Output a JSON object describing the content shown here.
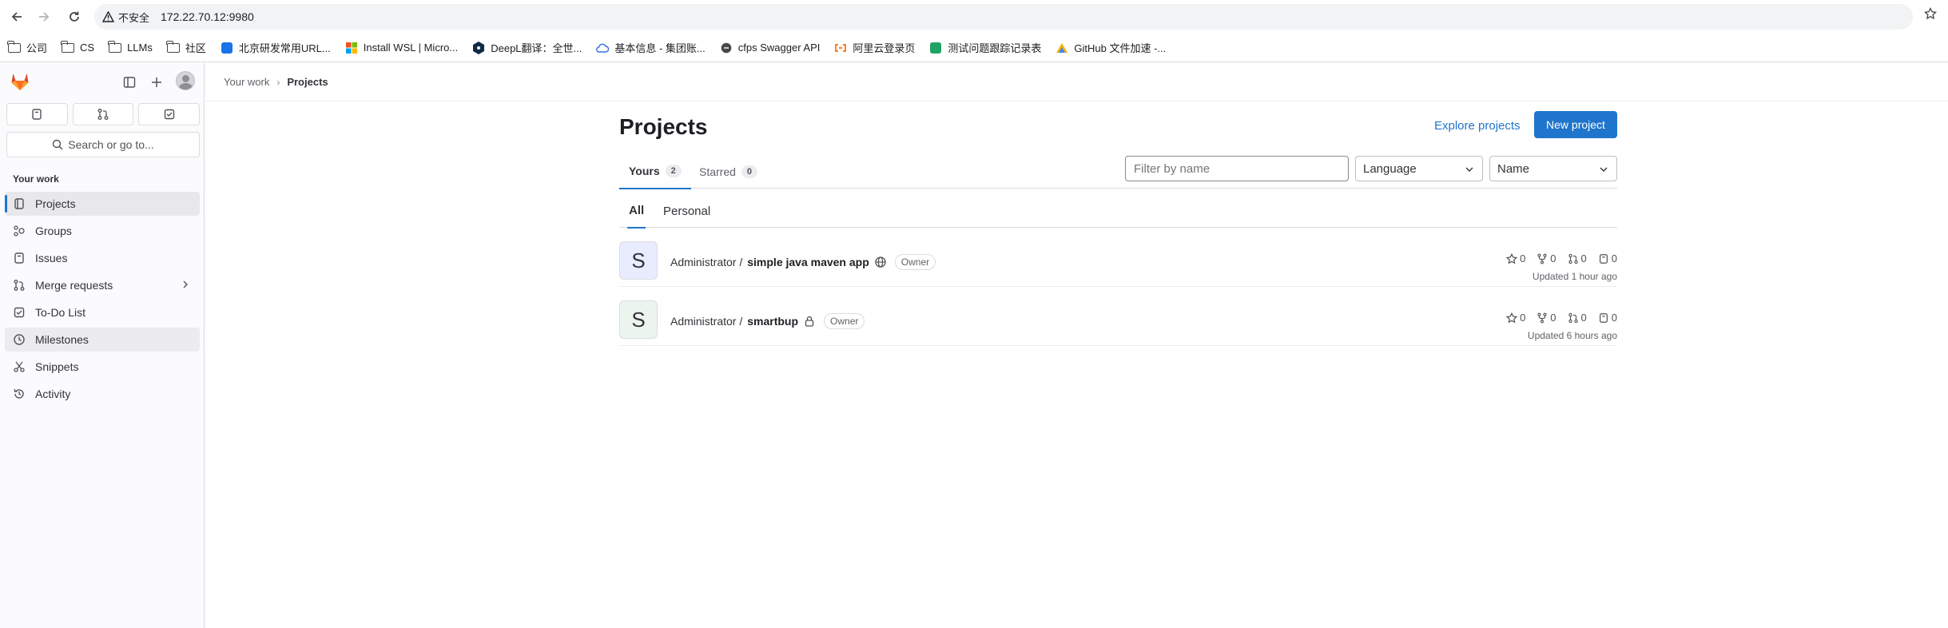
{
  "browser": {
    "security_label": "不安全",
    "url": "172.22.70.12:9980",
    "bookmarks": [
      {
        "label": "公司",
        "icon": "folder-icon"
      },
      {
        "label": "CS",
        "icon": "folder-icon"
      },
      {
        "label": "LLMs",
        "icon": "folder-icon"
      },
      {
        "label": "社区",
        "icon": "folder-icon"
      },
      {
        "label": "北京研发常用URL...",
        "icon": "bookmark-site-icon"
      },
      {
        "label": "Install WSL | Micro...",
        "icon": "microsoft-icon"
      },
      {
        "label": "DeepL翻译：全世...",
        "icon": "deepl-icon"
      },
      {
        "label": "基本信息 - 集团账...",
        "icon": "cloud-icon"
      },
      {
        "label": "cfps Swagger API",
        "icon": "swagger-icon"
      },
      {
        "label": "阿里云登录页",
        "icon": "aliyun-icon"
      },
      {
        "label": "测试问题跟踪记录表",
        "icon": "sheet-icon"
      },
      {
        "label": "GitHub 文件加速 -...",
        "icon": "github-accel-icon"
      }
    ]
  },
  "sidebar": {
    "search_label": "Search or go to...",
    "section_title": "Your work",
    "items": [
      {
        "label": "Projects",
        "icon": "project-icon"
      },
      {
        "label": "Groups",
        "icon": "group-icon"
      },
      {
        "label": "Issues",
        "icon": "issues-icon"
      },
      {
        "label": "Merge requests",
        "icon": "merge-request-icon"
      },
      {
        "label": "To-Do List",
        "icon": "todo-icon"
      },
      {
        "label": "Milestones",
        "icon": "milestone-icon"
      },
      {
        "label": "Snippets",
        "icon": "snippet-icon"
      },
      {
        "label": "Activity",
        "icon": "activity-icon"
      }
    ]
  },
  "breadcrumb": {
    "parent": "Your work",
    "current": "Projects"
  },
  "page": {
    "title": "Projects",
    "explore_label": "Explore projects",
    "new_project_label": "New project",
    "tabs": [
      {
        "label": "Yours",
        "count": "2"
      },
      {
        "label": "Starred",
        "count": "0"
      }
    ],
    "filter_placeholder": "Filter by name",
    "language_label": "Language",
    "sort_label": "Name",
    "subtabs": [
      "All",
      "Personal"
    ]
  },
  "projects": [
    {
      "avatar_letter": "S",
      "namespace": "Administrator /",
      "name": "simple java maven app",
      "visibility_icon": "globe-icon",
      "role": "Owner",
      "stars": "0",
      "forks": "0",
      "merge_requests": "0",
      "issues": "0",
      "updated": "Updated 1 hour ago",
      "avatar_color": "#e9ebff"
    },
    {
      "avatar_letter": "S",
      "namespace": "Administrator /",
      "name": "smartbup",
      "visibility_icon": "lock-icon",
      "role": "Owner",
      "stars": "0",
      "forks": "0",
      "merge_requests": "0",
      "issues": "0",
      "updated": "Updated 6 hours ago",
      "avatar_color": "#ecf4ee"
    }
  ]
}
